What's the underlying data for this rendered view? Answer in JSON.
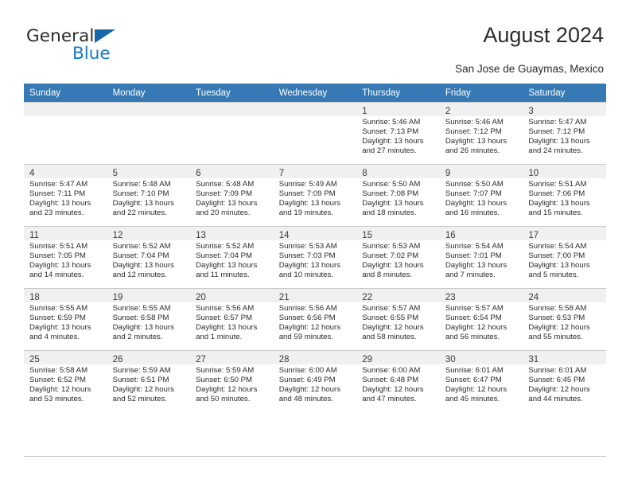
{
  "brand": {
    "name_part1": "General",
    "name_part2": "Blue",
    "triangle_color": "#1565a8",
    "blue_color": "#1779c4"
  },
  "header": {
    "title": "August 2024",
    "subtitle": "San Jose de Guaymas, Mexico",
    "header_bg": "#3679b5",
    "header_text_color": "#ffffff"
  },
  "weekday_headers": [
    "Sunday",
    "Monday",
    "Tuesday",
    "Wednesday",
    "Thursday",
    "Friday",
    "Saturday"
  ],
  "labels": {
    "sunrise_prefix": "Sunrise:",
    "sunset_prefix": "Sunset:",
    "daylight_prefix": "Daylight:"
  },
  "weeks": [
    [
      {
        "day": "",
        "empty": true
      },
      {
        "day": "",
        "empty": true
      },
      {
        "day": "",
        "empty": true
      },
      {
        "day": "",
        "empty": true
      },
      {
        "day": "1",
        "sunrise": "Sunrise: 5:46 AM",
        "sunset": "Sunset: 7:13 PM",
        "daylight_line1": "Daylight: 13 hours",
        "daylight_line2": "and 27 minutes."
      },
      {
        "day": "2",
        "sunrise": "Sunrise: 5:46 AM",
        "sunset": "Sunset: 7:12 PM",
        "daylight_line1": "Daylight: 13 hours",
        "daylight_line2": "and 26 minutes."
      },
      {
        "day": "3",
        "sunrise": "Sunrise: 5:47 AM",
        "sunset": "Sunset: 7:12 PM",
        "daylight_line1": "Daylight: 13 hours",
        "daylight_line2": "and 24 minutes."
      }
    ],
    [
      {
        "day": "4",
        "sunrise": "Sunrise: 5:47 AM",
        "sunset": "Sunset: 7:11 PM",
        "daylight_line1": "Daylight: 13 hours",
        "daylight_line2": "and 23 minutes."
      },
      {
        "day": "5",
        "sunrise": "Sunrise: 5:48 AM",
        "sunset": "Sunset: 7:10 PM",
        "daylight_line1": "Daylight: 13 hours",
        "daylight_line2": "and 22 minutes."
      },
      {
        "day": "6",
        "sunrise": "Sunrise: 5:48 AM",
        "sunset": "Sunset: 7:09 PM",
        "daylight_line1": "Daylight: 13 hours",
        "daylight_line2": "and 20 minutes."
      },
      {
        "day": "7",
        "sunrise": "Sunrise: 5:49 AM",
        "sunset": "Sunset: 7:09 PM",
        "daylight_line1": "Daylight: 13 hours",
        "daylight_line2": "and 19 minutes."
      },
      {
        "day": "8",
        "sunrise": "Sunrise: 5:50 AM",
        "sunset": "Sunset: 7:08 PM",
        "daylight_line1": "Daylight: 13 hours",
        "daylight_line2": "and 18 minutes."
      },
      {
        "day": "9",
        "sunrise": "Sunrise: 5:50 AM",
        "sunset": "Sunset: 7:07 PM",
        "daylight_line1": "Daylight: 13 hours",
        "daylight_line2": "and 16 minutes."
      },
      {
        "day": "10",
        "sunrise": "Sunrise: 5:51 AM",
        "sunset": "Sunset: 7:06 PM",
        "daylight_line1": "Daylight: 13 hours",
        "daylight_line2": "and 15 minutes."
      }
    ],
    [
      {
        "day": "11",
        "sunrise": "Sunrise: 5:51 AM",
        "sunset": "Sunset: 7:05 PM",
        "daylight_line1": "Daylight: 13 hours",
        "daylight_line2": "and 14 minutes."
      },
      {
        "day": "12",
        "sunrise": "Sunrise: 5:52 AM",
        "sunset": "Sunset: 7:04 PM",
        "daylight_line1": "Daylight: 13 hours",
        "daylight_line2": "and 12 minutes."
      },
      {
        "day": "13",
        "sunrise": "Sunrise: 5:52 AM",
        "sunset": "Sunset: 7:04 PM",
        "daylight_line1": "Daylight: 13 hours",
        "daylight_line2": "and 11 minutes."
      },
      {
        "day": "14",
        "sunrise": "Sunrise: 5:53 AM",
        "sunset": "Sunset: 7:03 PM",
        "daylight_line1": "Daylight: 13 hours",
        "daylight_line2": "and 10 minutes."
      },
      {
        "day": "15",
        "sunrise": "Sunrise: 5:53 AM",
        "sunset": "Sunset: 7:02 PM",
        "daylight_line1": "Daylight: 13 hours",
        "daylight_line2": "and 8 minutes."
      },
      {
        "day": "16",
        "sunrise": "Sunrise: 5:54 AM",
        "sunset": "Sunset: 7:01 PM",
        "daylight_line1": "Daylight: 13 hours",
        "daylight_line2": "and 7 minutes."
      },
      {
        "day": "17",
        "sunrise": "Sunrise: 5:54 AM",
        "sunset": "Sunset: 7:00 PM",
        "daylight_line1": "Daylight: 13 hours",
        "daylight_line2": "and 5 minutes."
      }
    ],
    [
      {
        "day": "18",
        "sunrise": "Sunrise: 5:55 AM",
        "sunset": "Sunset: 6:59 PM",
        "daylight_line1": "Daylight: 13 hours",
        "daylight_line2": "and 4 minutes."
      },
      {
        "day": "19",
        "sunrise": "Sunrise: 5:55 AM",
        "sunset": "Sunset: 6:58 PM",
        "daylight_line1": "Daylight: 13 hours",
        "daylight_line2": "and 2 minutes."
      },
      {
        "day": "20",
        "sunrise": "Sunrise: 5:56 AM",
        "sunset": "Sunset: 6:57 PM",
        "daylight_line1": "Daylight: 13 hours",
        "daylight_line2": "and 1 minute."
      },
      {
        "day": "21",
        "sunrise": "Sunrise: 5:56 AM",
        "sunset": "Sunset: 6:56 PM",
        "daylight_line1": "Daylight: 12 hours",
        "daylight_line2": "and 59 minutes."
      },
      {
        "day": "22",
        "sunrise": "Sunrise: 5:57 AM",
        "sunset": "Sunset: 6:55 PM",
        "daylight_line1": "Daylight: 12 hours",
        "daylight_line2": "and 58 minutes."
      },
      {
        "day": "23",
        "sunrise": "Sunrise: 5:57 AM",
        "sunset": "Sunset: 6:54 PM",
        "daylight_line1": "Daylight: 12 hours",
        "daylight_line2": "and 56 minutes."
      },
      {
        "day": "24",
        "sunrise": "Sunrise: 5:58 AM",
        "sunset": "Sunset: 6:53 PM",
        "daylight_line1": "Daylight: 12 hours",
        "daylight_line2": "and 55 minutes."
      }
    ],
    [
      {
        "day": "25",
        "sunrise": "Sunrise: 5:58 AM",
        "sunset": "Sunset: 6:52 PM",
        "daylight_line1": "Daylight: 12 hours",
        "daylight_line2": "and 53 minutes."
      },
      {
        "day": "26",
        "sunrise": "Sunrise: 5:59 AM",
        "sunset": "Sunset: 6:51 PM",
        "daylight_line1": "Daylight: 12 hours",
        "daylight_line2": "and 52 minutes."
      },
      {
        "day": "27",
        "sunrise": "Sunrise: 5:59 AM",
        "sunset": "Sunset: 6:50 PM",
        "daylight_line1": "Daylight: 12 hours",
        "daylight_line2": "and 50 minutes."
      },
      {
        "day": "28",
        "sunrise": "Sunrise: 6:00 AM",
        "sunset": "Sunset: 6:49 PM",
        "daylight_line1": "Daylight: 12 hours",
        "daylight_line2": "and 48 minutes."
      },
      {
        "day": "29",
        "sunrise": "Sunrise: 6:00 AM",
        "sunset": "Sunset: 6:48 PM",
        "daylight_line1": "Daylight: 12 hours",
        "daylight_line2": "and 47 minutes."
      },
      {
        "day": "30",
        "sunrise": "Sunrise: 6:01 AM",
        "sunset": "Sunset: 6:47 PM",
        "daylight_line1": "Daylight: 12 hours",
        "daylight_line2": "and 45 minutes."
      },
      {
        "day": "31",
        "sunrise": "Sunrise: 6:01 AM",
        "sunset": "Sunset: 6:45 PM",
        "daylight_line1": "Daylight: 12 hours",
        "daylight_line2": "and 44 minutes."
      }
    ]
  ]
}
